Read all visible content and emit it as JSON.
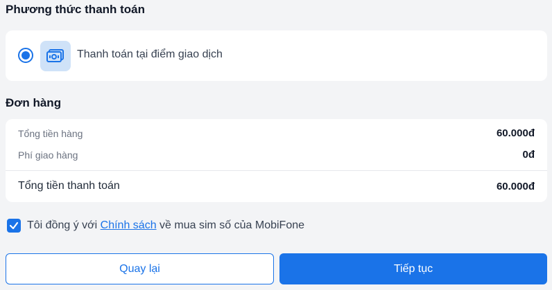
{
  "payment": {
    "title": "Phương thức thanh toán",
    "option_label": "Thanh toán tại điểm giao dịch",
    "option_icon": "cash-icon",
    "selected": true
  },
  "order": {
    "title": "Đơn hàng",
    "rows": [
      {
        "label": "Tổng tiền hàng",
        "value": "60.000đ"
      },
      {
        "label": "Phí giao hàng",
        "value": "0đ"
      }
    ],
    "total": {
      "label": "Tổng tiền thanh toán",
      "value": "60.000đ"
    }
  },
  "agreement": {
    "checked": true,
    "prefix": "Tôi đồng ý với ",
    "link": "Chính sách",
    "suffix": " về mua sim số của MobiFone"
  },
  "buttons": {
    "back": "Quay lại",
    "next": "Tiếp tục"
  },
  "colors": {
    "accent": "#1a73e8",
    "background": "#f3f4f6",
    "icon_bg": "#cfe2f8"
  }
}
